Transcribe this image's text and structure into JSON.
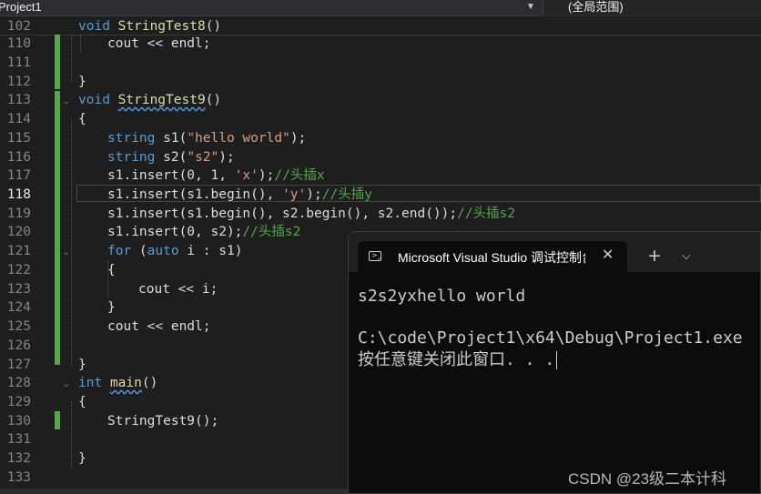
{
  "toolbar": {
    "project": "Project1",
    "scope": "(全局范围)"
  },
  "editor": {
    "sticky": {
      "line_no": "102",
      "kw": "void",
      "fn": "StringTest8",
      "rest": "()"
    },
    "current_line": "118",
    "lines": [
      {
        "no": "110",
        "t1": "cout << endl;"
      },
      {
        "no": "111"
      },
      {
        "no": "112",
        "t1": "}"
      },
      {
        "no": "113",
        "kw": "void",
        "fn": "StringTest9",
        "rest": "()"
      },
      {
        "no": "114",
        "t1": "{"
      },
      {
        "no": "115",
        "kw": "string",
        "t1": " s1(",
        "str": "\"hello world\"",
        "t2": ");"
      },
      {
        "no": "116",
        "kw": "string",
        "t1": " s2(",
        "str": "\"s2\"",
        "t2": ");"
      },
      {
        "no": "117",
        "t1": "s1.insert(0, 1, ",
        "str": "'x'",
        "t2": ");",
        "cm": "//头插x"
      },
      {
        "no": "118",
        "t1": "s1.insert(s1.begin(), ",
        "str": "'y'",
        "t2": ");",
        "cm": "//头插y"
      },
      {
        "no": "119",
        "t1": "s1.insert(s1.begin(), s2.begin(), s2.end());",
        "cm": "//头插s2"
      },
      {
        "no": "120",
        "t1": "s1.insert(0, s2);",
        "cm": "//头插s2"
      },
      {
        "no": "121",
        "kw": "for",
        "t1": " (",
        "kw2": "auto",
        "t2": " i : s1)"
      },
      {
        "no": "122",
        "t1": "{"
      },
      {
        "no": "123",
        "t1": "cout << i;"
      },
      {
        "no": "124",
        "t1": "}"
      },
      {
        "no": "125",
        "t1": "cout << endl;"
      },
      {
        "no": "126"
      },
      {
        "no": "127",
        "t1": "}"
      },
      {
        "no": "128",
        "kw": "int",
        "fn": "main",
        "rest": "()"
      },
      {
        "no": "129",
        "t1": "{"
      },
      {
        "no": "130",
        "t1": "StringTest9();"
      },
      {
        "no": "131"
      },
      {
        "no": "132",
        "t1": "}"
      },
      {
        "no": "133"
      }
    ]
  },
  "terminal": {
    "tab_title": "Microsoft Visual Studio 调试控制台",
    "output": [
      "s2s2yxhello world",
      "",
      "C:\\code\\Project1\\x64\\Debug\\Project1.exe",
      "按任意键关闭此窗口. . ."
    ]
  },
  "watermark": "CSDN @23级二本计科"
}
